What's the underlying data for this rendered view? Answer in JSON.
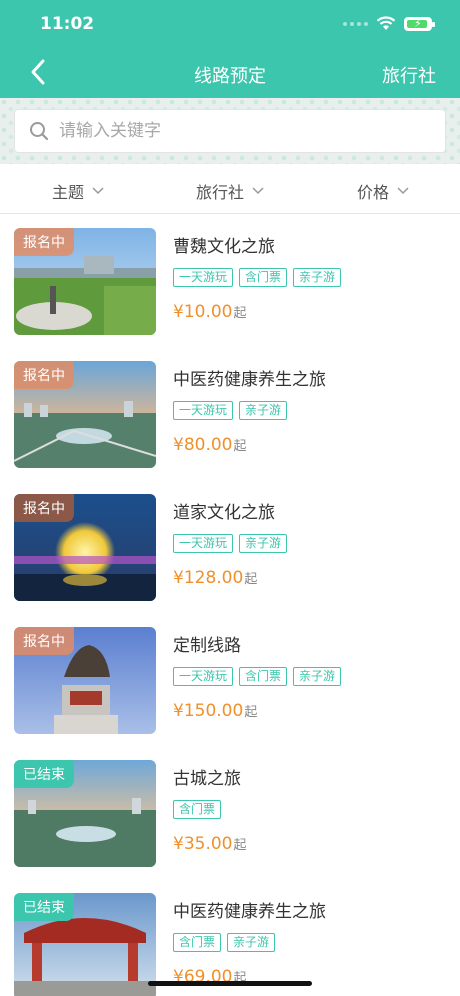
{
  "status_bar": {
    "time": "11:02"
  },
  "nav": {
    "title": "线路预定",
    "right_label": "旅行社"
  },
  "search": {
    "placeholder": "请输入关键字"
  },
  "filters": [
    {
      "label": "主题"
    },
    {
      "label": "旅行社"
    },
    {
      "label": "价格"
    }
  ],
  "colors": {
    "accent": "#3cc6ad",
    "price": "#f0902c",
    "badge_active": "rgba(226,140,100,0.85)",
    "badge_ended": "#3cc6ad"
  },
  "routes": [
    {
      "status": "报名中",
      "title": "曹魏文化之旅",
      "tags": [
        "一天游玩",
        "含门票",
        "亲子游"
      ],
      "price": "¥10.00",
      "price_suffix": "起"
    },
    {
      "status": "报名中",
      "title": "中医药健康养生之旅",
      "tags": [
        "一天游玩",
        "亲子游"
      ],
      "price": "¥80.00",
      "price_suffix": "起"
    },
    {
      "status": "报名中",
      "title": "道家文化之旅",
      "tags": [
        "一天游玩",
        "亲子游"
      ],
      "price": "¥128.00",
      "price_suffix": "起"
    },
    {
      "status": "报名中",
      "title": "定制线路",
      "tags": [
        "一天游玩",
        "含门票",
        "亲子游"
      ],
      "price": "¥150.00",
      "price_suffix": "起"
    },
    {
      "status": "已结束",
      "title": "古城之旅",
      "tags": [
        "含门票"
      ],
      "price": "¥35.00",
      "price_suffix": "起"
    },
    {
      "status": "已结束",
      "title": "中医药健康养生之旅",
      "tags": [
        "含门票",
        "亲子游"
      ],
      "price": "¥69.00",
      "price_suffix": "起"
    }
  ]
}
